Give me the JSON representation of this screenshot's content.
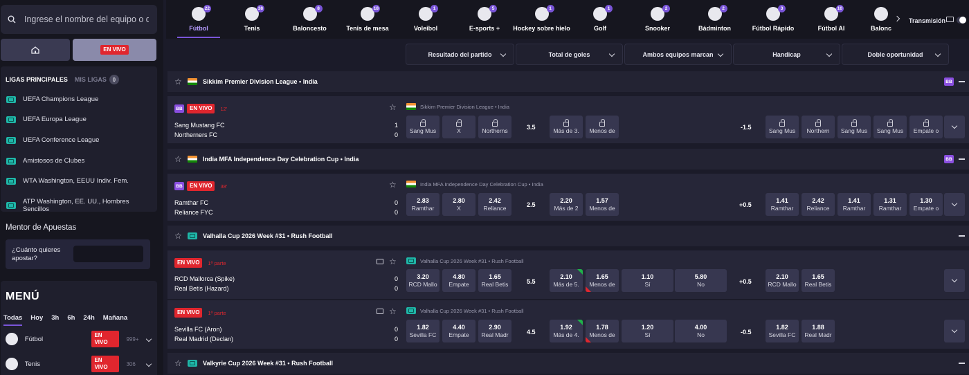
{
  "search": {
    "placeholder": "Ingrese el nombre del equipo o d..."
  },
  "sidebar": {
    "live_label": "EN VIVO",
    "tabs": {
      "main": "LIGAS PRINCIPALES",
      "mine": "MIS LIGAS",
      "mine_count": "0"
    },
    "leagues": [
      "UEFA Champions League",
      "UEFA Europa League",
      "UEFA Conference League",
      "Amistosos de Clubes",
      "WTA Washington, EEUU Indiv. Fem.",
      "ATP Washington, EE. UU., Hombres Sencillos"
    ],
    "mentor": {
      "title": "Mentor de Apuestas",
      "question": "¿Cuánto quieres apostar?"
    },
    "menu": {
      "title": "MENÚ",
      "filters": [
        "Todas",
        "Hoy",
        "3h",
        "6h",
        "24h",
        "Mañana"
      ],
      "sports": [
        {
          "name": "Fútbol",
          "live": "EN VIVO",
          "count": "999+"
        },
        {
          "name": "Tenis",
          "live": "EN VIVO",
          "count": "306"
        }
      ]
    }
  },
  "topnav": {
    "sports": [
      {
        "label": "Fútbol",
        "count": "22"
      },
      {
        "label": "Tenis",
        "count": "38"
      },
      {
        "label": "Baloncesto",
        "count": "8"
      },
      {
        "label": "Tenis de mesa",
        "count": "18"
      },
      {
        "label": "Voleibol",
        "count": "1"
      },
      {
        "label": "E-sports +",
        "count": "5"
      },
      {
        "label": "Hockey sobre hielo",
        "count": "1"
      },
      {
        "label": "Golf",
        "count": "1"
      },
      {
        "label": "Snooker",
        "count": "2"
      },
      {
        "label": "Bádminton",
        "count": "2"
      },
      {
        "label": "Fútbol Rápido",
        "count": "3"
      },
      {
        "label": "Fútbol AI",
        "count": "10"
      },
      {
        "label": "Balonc",
        "count": ""
      }
    ],
    "transmision": "Transmisión"
  },
  "markets": [
    "Resultado del partido",
    "Total de goles",
    "Ambos equipos marcan",
    "Handicap",
    "Doble oportunidad"
  ],
  "leagues": [
    {
      "name": "Sikkim Premier Division League • India",
      "bb": "BB",
      "match": {
        "bb": "BB",
        "live": "EN VIVO",
        "time": "12'",
        "league": "Sikkim Premier Division League • India",
        "home": "Sang Mustang FC",
        "away": "Northerners FC",
        "score_home": "1",
        "score_away": "0",
        "result": [
          {
            "odd": "",
            "sel": "Sang Mus"
          },
          {
            "odd": "",
            "sel": "X"
          },
          {
            "odd": "",
            "sel": "Northerns"
          }
        ],
        "total_line": "3.5",
        "totals": [
          {
            "odd": "",
            "sel": "Más de 3."
          },
          {
            "odd": "",
            "sel": "Menos de"
          }
        ],
        "hcp_line": "-1.5",
        "hcp": [
          {
            "odd": "",
            "sel": "Sang Mus"
          },
          {
            "odd": "",
            "sel": "Northern"
          },
          {
            "odd": "",
            "sel": "Sang Mus"
          },
          {
            "odd": "",
            "sel": "Sang Mus"
          },
          {
            "odd": "",
            "sel": "Empate o"
          }
        ]
      }
    },
    {
      "name": "India MFA Independence Day Celebration Cup • India",
      "bb": "BB",
      "match": {
        "bb": "BB",
        "live": "EN VIVO",
        "time": "38'",
        "league": "India MFA Independence Day Celebration Cup • India",
        "home": "Ramthar FC",
        "away": "Reliance FYC",
        "score_home": "0",
        "score_away": "0",
        "result": [
          {
            "odd": "2.83",
            "sel": "Ramthar"
          },
          {
            "odd": "2.80",
            "sel": "X"
          },
          {
            "odd": "2.42",
            "sel": "Reliance"
          }
        ],
        "total_line": "2.5",
        "totals": [
          {
            "odd": "2.20",
            "sel": "Más de 2"
          },
          {
            "odd": "1.57",
            "sel": "Menos de"
          }
        ],
        "hcp_line": "+0.5",
        "hcp": [
          {
            "odd": "1.41",
            "sel": "Ramthar"
          },
          {
            "odd": "2.42",
            "sel": "Reliance"
          },
          {
            "odd": "1.41",
            "sel": "Ramthar"
          },
          {
            "odd": "1.31",
            "sel": "Ramthar"
          },
          {
            "odd": "1.30",
            "sel": "Empate o"
          }
        ]
      }
    },
    {
      "name": "Valhalla Cup 2026 Week #31 • Rush Football",
      "matches": [
        {
          "live": "EN VIVO",
          "time": "1ª parte",
          "league": "Valhalla Cup 2026 Week #31 • Rush Football",
          "home": "RCD Mallorca (Spike)",
          "away": "Real Betis (Hazard)",
          "score_home": "0",
          "score_away": "0",
          "result": [
            {
              "odd": "3.20",
              "sel": "RCD Mallo"
            },
            {
              "odd": "4.80",
              "sel": "Empate"
            },
            {
              "odd": "1.65",
              "sel": "Real Betis"
            }
          ],
          "total_line": "5.5",
          "totals": [
            {
              "odd": "2.10",
              "sel": "Más de 5."
            },
            {
              "odd": "1.65",
              "sel": "Menos de"
            }
          ],
          "btts": [
            {
              "odd": "1.10",
              "sel": "Sí"
            },
            {
              "odd": "5.80",
              "sel": "No"
            }
          ],
          "hcp_line": "+0.5",
          "hcp": [
            {
              "odd": "2.10",
              "sel": "RCD Mallo"
            },
            {
              "odd": "1.65",
              "sel": "Real Betis"
            }
          ]
        },
        {
          "live": "EN VIVO",
          "time": "1ª parte",
          "league": "Valhalla Cup 2026 Week #31 • Rush Football",
          "home": "Sevilla FC (Aron)",
          "away": "Real Madrid (Declan)",
          "score_home": "0",
          "score_away": "0",
          "result": [
            {
              "odd": "1.82",
              "sel": "Sevilla FC"
            },
            {
              "odd": "4.40",
              "sel": "Empate"
            },
            {
              "odd": "2.90",
              "sel": "Real Madr"
            }
          ],
          "total_line": "4.5",
          "totals": [
            {
              "odd": "1.92",
              "sel": "Más de 4."
            },
            {
              "odd": "1.78",
              "sel": "Menos de"
            }
          ],
          "btts": [
            {
              "odd": "1.20",
              "sel": "Sí"
            },
            {
              "odd": "4.00",
              "sel": "No"
            }
          ],
          "hcp_line": "-0.5",
          "hcp": [
            {
              "odd": "1.82",
              "sel": "Sevilla FC"
            },
            {
              "odd": "1.88",
              "sel": "Real Madr"
            }
          ]
        }
      ]
    },
    {
      "name": "Valkyrie Cup 2026 Week #31 • Rush Football"
    }
  ],
  "colors": {
    "accent": "#7a55d8",
    "live": "#e0262e",
    "odd_button": "#373750"
  }
}
